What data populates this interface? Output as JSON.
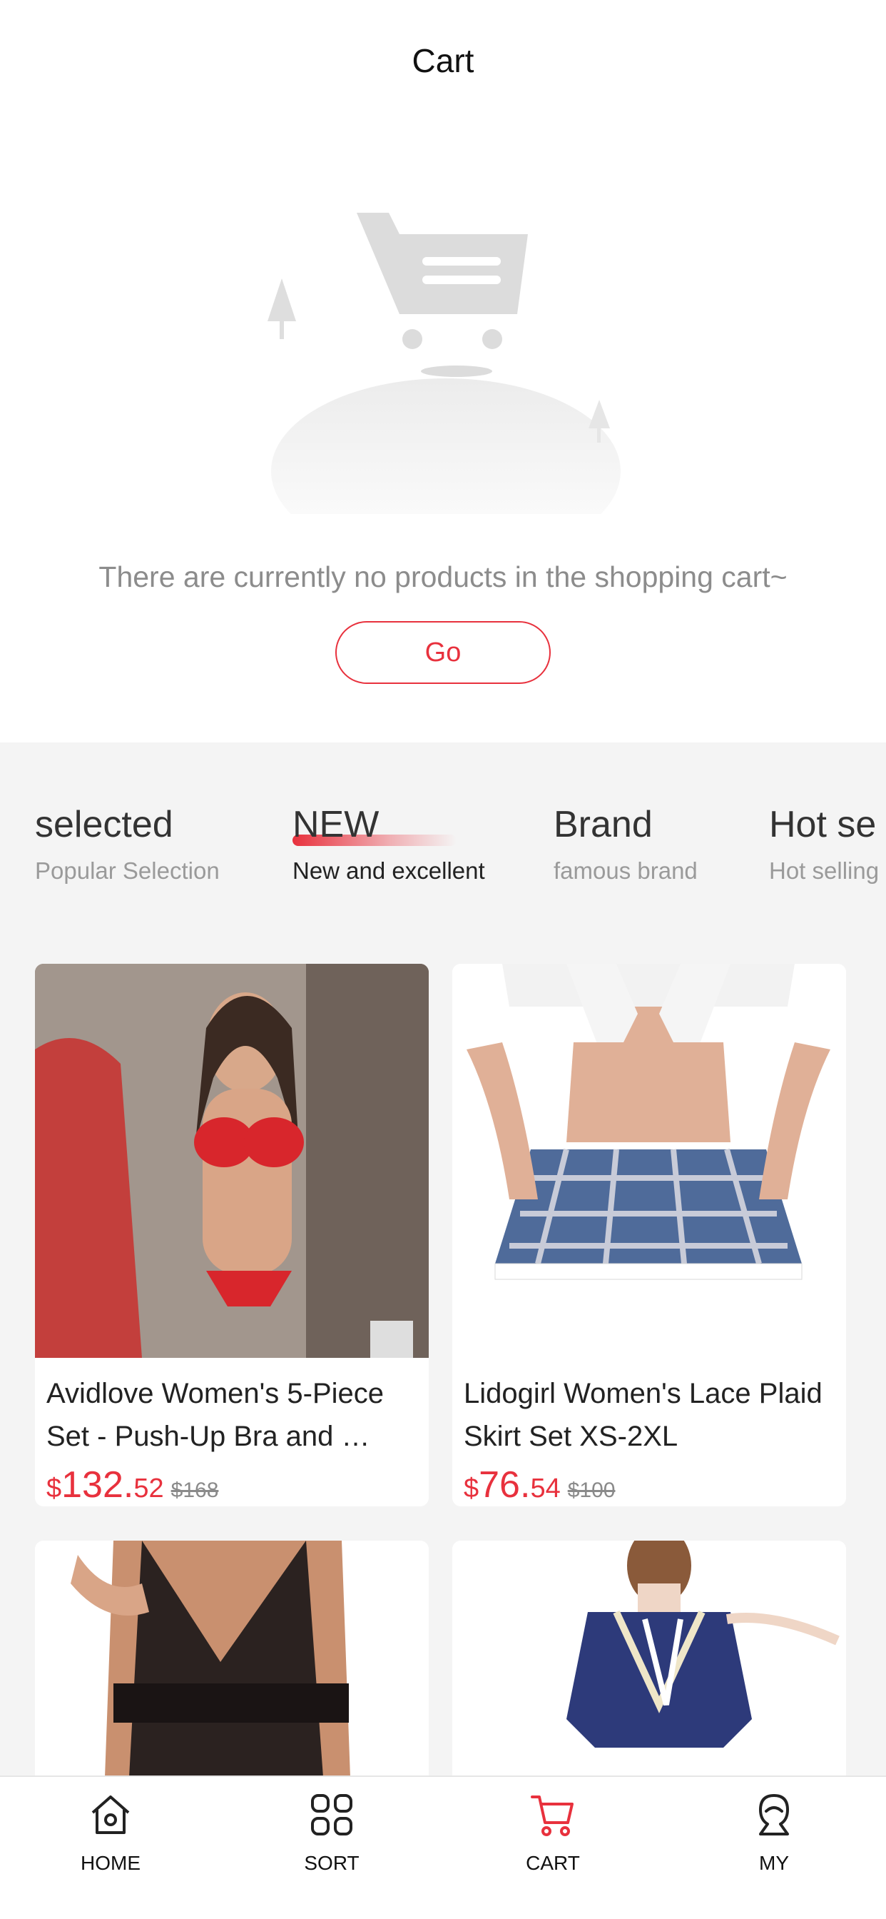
{
  "header": {
    "title": "Cart"
  },
  "empty_state": {
    "message": "There are currently no products in the shopping cart~",
    "button_label": "Go"
  },
  "category_tabs": [
    {
      "title": "selected",
      "subtitle": "Popular Selection",
      "active": false
    },
    {
      "title": "NEW",
      "subtitle": "New and excellent",
      "active": true
    },
    {
      "title": "Brand",
      "subtitle": "famous brand",
      "active": false
    },
    {
      "title": "Hot se",
      "subtitle": "Hot selling",
      "active": false
    }
  ],
  "products": [
    {
      "name": "Avidlove Women's 5-Piece Set - Push-Up Bra and …",
      "currency": "$",
      "price_int": "132.",
      "price_dec": "52",
      "original_price": "$168",
      "image": "red-lingerie-set-photo"
    },
    {
      "name": "Lidogirl Women's Lace Plaid Skirt Set XS-2XL",
      "currency": "$",
      "price_int": "76.",
      "price_dec": "54",
      "original_price": "$100",
      "image": "plaid-skirt-set-photo"
    },
    {
      "name": "",
      "image": "black-lace-dress-photo"
    },
    {
      "name": "",
      "image": "navy-uniform-top-photo"
    }
  ],
  "tabbar": [
    {
      "label": "HOME",
      "icon": "home-icon",
      "active": false
    },
    {
      "label": "SORT",
      "icon": "grid-icon",
      "active": false
    },
    {
      "label": "CART",
      "icon": "cart-icon",
      "active": true
    },
    {
      "label": "MY",
      "icon": "user-icon",
      "active": false
    }
  ],
  "colors": {
    "accent": "#e8313d",
    "background_gray": "#f4f4f4",
    "muted_text": "#8c8c8c"
  }
}
